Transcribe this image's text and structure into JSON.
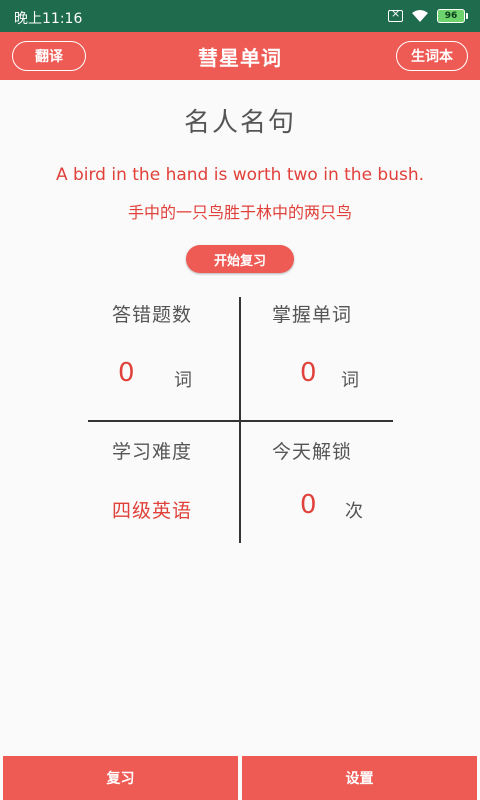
{
  "status_bar": {
    "time": "晚上11:16",
    "battery": "96"
  },
  "app_bar": {
    "title": "彗星单词",
    "translate_label": "翻译",
    "vocab_label": "生词本"
  },
  "quote": {
    "section_title": "名人名句",
    "english": "A bird in the hand is worth two in the bush.",
    "chinese": "手中的一只鸟胜于林中的两只鸟"
  },
  "review_button": "开始复习",
  "stats": {
    "wrong": {
      "label": "答错题数",
      "value": "0",
      "unit": "词"
    },
    "mastered": {
      "label": "掌握单词",
      "value": "0",
      "unit": "词"
    },
    "difficulty": {
      "label": "学习难度",
      "value": "四级英语"
    },
    "unlock": {
      "label": "今天解锁",
      "value": "0",
      "unit": "次"
    }
  },
  "bottom_nav": {
    "review": "复习",
    "settings": "设置"
  },
  "colors": {
    "status_bar": "#1e6b4e",
    "primary": "#ee5a54",
    "accent_text": "#e0413a"
  }
}
